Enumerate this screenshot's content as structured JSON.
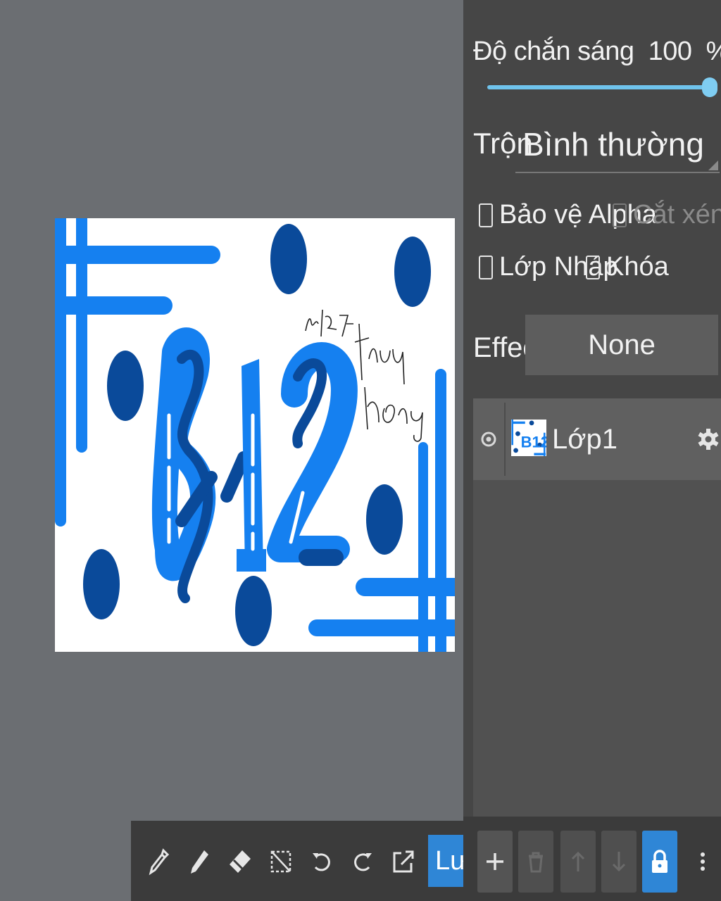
{
  "canvas": {
    "artwork_text": "B12",
    "handwriting": [
      "nđ 247",
      "thuy",
      "hong"
    ]
  },
  "toolbar": {
    "tools": [
      "eyedropper-icon",
      "pen-icon",
      "eraser-icon",
      "selection-icon",
      "undo-icon",
      "redo-icon",
      "export-icon"
    ],
    "save_label": "Lưu"
  },
  "layer_panel": {
    "opacity_label": "Độ chắn sáng",
    "opacity_value": "100",
    "opacity_unit": "%",
    "opacity_level": 1.0,
    "blend_label": "Trộn",
    "blend_value": "Bình thường",
    "protect_alpha": "Bảo vệ Alpha",
    "clipping": "Cắt xén",
    "draft_layer": "Lớp Nháp",
    "lock": "Khóa",
    "effect_label": "Effect",
    "effect_value": "None",
    "layers": [
      {
        "name": "Lớp1",
        "visible": true
      }
    ]
  },
  "colors": {
    "accent": "#2f86d6",
    "canvas_bg": "#6b6e72",
    "panel_bg": "#464646",
    "bright_blue": "#1580f0",
    "dark_blue": "#0a4a9a"
  }
}
